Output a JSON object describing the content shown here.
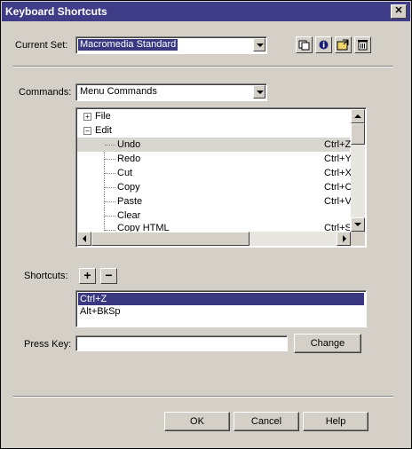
{
  "window": {
    "title": "Keyboard Shortcuts",
    "close_label": "✕"
  },
  "current_set": {
    "label": "Current Set:",
    "value": "Macromedia Standard"
  },
  "toolbar": {
    "icons": [
      "duplicate-set-icon",
      "info-icon",
      "export-html-icon",
      "delete-set-icon"
    ]
  },
  "commands": {
    "label": "Commands:",
    "value": "Menu Commands"
  },
  "tree": {
    "groups": [
      {
        "label": "File",
        "expander": "+"
      },
      {
        "label": "Edit",
        "expander": "−"
      }
    ],
    "items": [
      {
        "label": "Undo",
        "shortcut": "Ctrl+Z",
        "selected": true
      },
      {
        "label": "Redo",
        "shortcut": "Ctrl+Y"
      },
      {
        "label": "Cut",
        "shortcut": "Ctrl+X"
      },
      {
        "label": "Copy",
        "shortcut": "Ctrl+C"
      },
      {
        "label": "Paste",
        "shortcut": "Ctrl+V"
      },
      {
        "label": "Clear",
        "shortcut": ""
      },
      {
        "label": "Copy HTML",
        "shortcut": "Ctrl+S"
      }
    ]
  },
  "shortcuts": {
    "label": "Shortcuts:",
    "add": "+",
    "remove": "−",
    "list": [
      "Ctrl+Z",
      "Alt+BkSp"
    ]
  },
  "press_key": {
    "label": "Press Key:",
    "value": "",
    "change_label": "Change"
  },
  "footer": {
    "ok": "OK",
    "cancel": "Cancel",
    "help": "Help"
  },
  "colors": {
    "titlebar": "#403d88",
    "selection": "#3a3880",
    "dialog": "#d4d0c8"
  }
}
